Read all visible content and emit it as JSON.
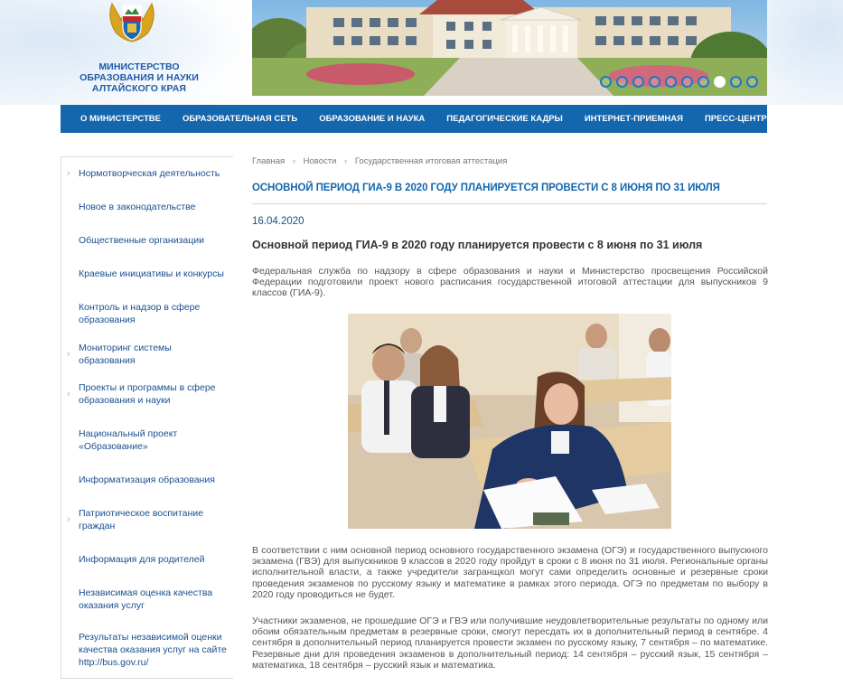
{
  "ministry": {
    "line1": "МИНИСТЕРСТВО",
    "line2": "ОБРАЗОВАНИЯ И НАУКИ",
    "line3": "АЛТАЙСКОГО КРАЯ"
  },
  "banner": {
    "slide_count": 10,
    "active_slide": 7
  },
  "nav": {
    "items": [
      "О МИНИСТЕРСТВЕ",
      "ОБРАЗОВАТЕЛЬНАЯ СЕТЬ",
      "ОБРАЗОВАНИЕ И НАУКА",
      "ПЕДАГОГИЧЕСКИЕ КАДРЫ",
      "ИНТЕРНЕТ-ПРИЕМНАЯ",
      "ПРЕСС-ЦЕНТР"
    ]
  },
  "sidebar": {
    "items": [
      {
        "label": "Нормотворческая деятельность",
        "has_arrow": true
      },
      {
        "label": "Новое в законодательстве",
        "has_arrow": false
      },
      {
        "label": "Общественные организации",
        "has_arrow": false
      },
      {
        "label": "Краевые инициативы и конкурсы",
        "has_arrow": false
      },
      {
        "label": "Контроль и надзор в сфере образования",
        "has_arrow": false
      },
      {
        "label": "Мониторинг системы образования",
        "has_arrow": true
      },
      {
        "label": "Проекты и программы в сфере образования и науки",
        "has_arrow": true
      },
      {
        "label": "Национальный проект «Образование»",
        "has_arrow": false
      },
      {
        "label": "Информатизация образования",
        "has_arrow": false
      },
      {
        "label": "Патриотическое воспитание граждан",
        "has_arrow": true
      },
      {
        "label": "Информация для родителей",
        "has_arrow": false
      },
      {
        "label": "Независимая оценка качества оказания услуг",
        "has_arrow": false
      },
      {
        "label": "Результаты независимой оценки качества оказания услуг на сайте http://bus.gov.ru/",
        "has_arrow": false
      }
    ]
  },
  "breadcrumb": {
    "items": [
      "Главная",
      "Новости",
      "Государственная итоговая аттестация"
    ],
    "separator": "›"
  },
  "article": {
    "title": "ОСНОВНОЙ ПЕРИОД ГИА-9 В 2020 ГОДУ ПЛАНИРУЕТСЯ ПРОВЕСТИ С 8 ИЮНЯ ПО 31 ИЮЛЯ",
    "date": "16.04.2020",
    "subtitle": "Основной период ГИА-9 в 2020 году планируется провести с 8 июня по 31 июля",
    "para1": "Федеральная служба по надзору в сфере образования и науки и Министерство просвещения Российской Федерации подготовили проект нового расписания государственной итоговой аттестации для выпускников 9 классов (ГИА-9).",
    "para2": "В соответствии с ним основной период основного государственного экзамена (ОГЭ) и государственного выпускного экзамена (ГВЭ) для выпускников 9 классов в 2020 году пройдут в сроки с 8 июня по 31 июля. Региональные органы исполнительной власти, а также учредители загранщкол могут сами определить основные и резервные сроки проведения экзаменов по русскому языку и математике в рамках этого периода. ОГЭ по предметам по выбору в 2020 году проводиться не будет.",
    "para3": "Участники экзаменов, не прошедшие ОГЭ и ГВЭ или получившие неудовлетворительные результаты по одному или обоим обязательным предметам в резервные сроки, смогут пересдать их в дополнительный период в сентябре. 4 сентября в дополнительный период планируется провести экзамен по русскому языку, 7 сентября – по математике. Резервные дни для проведения экзаменов в дополнительный период: 14 сентября – русский язык, 15 сентября – математика, 18 сентября – русский язык и математика."
  },
  "colors": {
    "nav_bg": "#1466ad",
    "title": "#1466ad",
    "link": "#1a4f8f"
  }
}
